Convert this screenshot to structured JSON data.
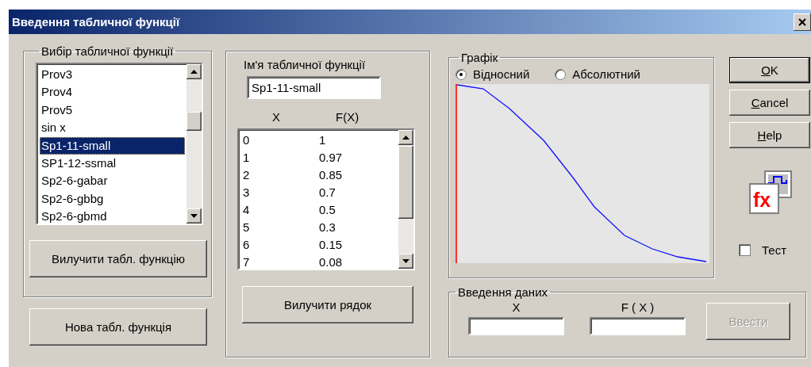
{
  "window": {
    "title": "Введення табличної функції"
  },
  "function_list": {
    "title": "Вибір табличної функції",
    "items": [
      {
        "label": "Prov3",
        "selected": false
      },
      {
        "label": "Prov4",
        "selected": false
      },
      {
        "label": "Prov5",
        "selected": false
      },
      {
        "label": "sin x",
        "selected": false
      },
      {
        "label": "Sp1-11-small",
        "selected": true
      },
      {
        "label": "SP1-12-ssmal",
        "selected": false
      },
      {
        "label": "Sp2-6-gabar",
        "selected": false
      },
      {
        "label": "Sp2-6-gbbg",
        "selected": false
      },
      {
        "label": "Sp2-6-gbmd",
        "selected": false
      }
    ],
    "delete_button": {
      "label": "Вилучити табл. функцію",
      "disabled": false
    }
  },
  "new_button": {
    "label": "Нова табл. функція",
    "disabled": false
  },
  "function_table": {
    "title": "Ім'я табличної функції",
    "name_value": "Sp1-11-small",
    "columns": [
      "X",
      "F(X)"
    ],
    "rows": [
      [
        "0",
        "1"
      ],
      [
        "1",
        "0.97"
      ],
      [
        "2",
        "0.85"
      ],
      [
        "3",
        "0.7"
      ],
      [
        "4",
        "0.5"
      ],
      [
        "5",
        "0.3"
      ],
      [
        "6",
        "0.15"
      ],
      [
        "7",
        "0.08"
      ]
    ],
    "delete_row_button": {
      "label": "Вилучити  рядок",
      "disabled": false
    }
  },
  "graph": {
    "title": "Графік",
    "modes": [
      {
        "label": "Відносний",
        "selected": true
      },
      {
        "label": "Абсолютний",
        "selected": false
      }
    ]
  },
  "buttons": [
    {
      "label": "OK",
      "default": true,
      "disabled": false
    },
    {
      "label": "Cancel",
      "default": false,
      "disabled": false
    },
    {
      "label": "Help",
      "default": false,
      "disabled": false
    }
  ],
  "logo": {
    "label": "fx"
  },
  "test": {
    "label": "Тест",
    "checked": false
  },
  "data_entry": {
    "title": "Введення даних",
    "fields": [
      {
        "label": "X"
      },
      {
        "label": "F ( X )"
      }
    ],
    "enter_button": {
      "label": "Ввести",
      "disabled": true
    }
  }
}
